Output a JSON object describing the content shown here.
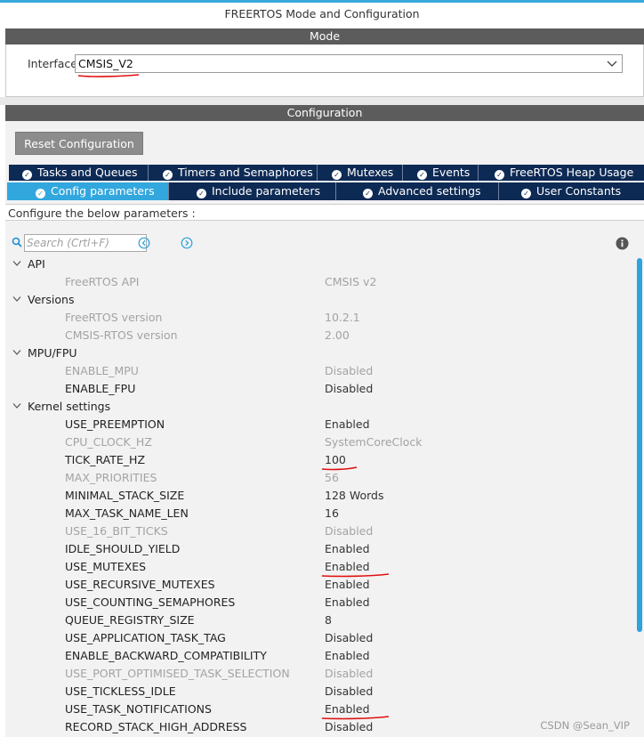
{
  "window": {
    "title": "FREERTOS Mode and Configuration"
  },
  "mode": {
    "header": "Mode",
    "interface_label": "Interface",
    "interface_value": "CMSIS_V2"
  },
  "configuration": {
    "header": "Configuration",
    "reset_label": "Reset Configuration",
    "tabs_row1": [
      {
        "label": "Tasks and Queues",
        "icon": "check-circle-icon"
      },
      {
        "label": "Timers and Semaphores",
        "icon": "check-circle-icon"
      },
      {
        "label": "Mutexes",
        "icon": "check-circle-icon"
      },
      {
        "label": "Events",
        "icon": "check-circle-icon"
      },
      {
        "label": "FreeRTOS Heap Usage",
        "icon": "check-circle-icon"
      }
    ],
    "tabs_row2": [
      {
        "label": "Config parameters",
        "icon": "check-circle-icon",
        "active": true
      },
      {
        "label": "Include parameters",
        "icon": "check-circle-icon"
      },
      {
        "label": "Advanced settings",
        "icon": "check-circle-icon"
      },
      {
        "label": "User Constants",
        "icon": "check-circle-icon"
      }
    ],
    "info_text": "Configure the below parameters :",
    "search_placeholder": "Search (Crtl+F)"
  },
  "groups": [
    {
      "label": "API",
      "params": [
        {
          "name": "FreeRTOS API",
          "value": "CMSIS v2",
          "disabled": true
        }
      ]
    },
    {
      "label": "Versions",
      "params": [
        {
          "name": "FreeRTOS version",
          "value": "10.2.1",
          "disabled": true
        },
        {
          "name": "CMSIS-RTOS version",
          "value": "2.00",
          "disabled": true
        }
      ]
    },
    {
      "label": "MPU/FPU",
      "params": [
        {
          "name": "ENABLE_MPU",
          "value": "Disabled",
          "disabled": true
        },
        {
          "name": "ENABLE_FPU",
          "value": "Disabled",
          "disabled": false
        }
      ]
    },
    {
      "label": "Kernel settings",
      "params": [
        {
          "name": "USE_PREEMPTION",
          "value": "Enabled",
          "disabled": false
        },
        {
          "name": "CPU_CLOCK_HZ",
          "value": "SystemCoreClock",
          "disabled": true
        },
        {
          "name": "TICK_RATE_HZ",
          "value": "100",
          "disabled": false,
          "marked": true
        },
        {
          "name": "MAX_PRIORITIES",
          "value": "56",
          "disabled": true
        },
        {
          "name": "MINIMAL_STACK_SIZE",
          "value": "128 Words",
          "disabled": false
        },
        {
          "name": "MAX_TASK_NAME_LEN",
          "value": "16",
          "disabled": false
        },
        {
          "name": "USE_16_BIT_TICKS",
          "value": "Disabled",
          "disabled": true
        },
        {
          "name": "IDLE_SHOULD_YIELD",
          "value": "Enabled",
          "disabled": false
        },
        {
          "name": "USE_MUTEXES",
          "value": "Enabled",
          "disabled": false,
          "marked": true
        },
        {
          "name": "USE_RECURSIVE_MUTEXES",
          "value": "Enabled",
          "disabled": false
        },
        {
          "name": "USE_COUNTING_SEMAPHORES",
          "value": "Enabled",
          "disabled": false
        },
        {
          "name": "QUEUE_REGISTRY_SIZE",
          "value": "8",
          "disabled": false
        },
        {
          "name": "USE_APPLICATION_TASK_TAG",
          "value": "Disabled",
          "disabled": false
        },
        {
          "name": "ENABLE_BACKWARD_COMPATIBILITY",
          "value": "Enabled",
          "disabled": false
        },
        {
          "name": "USE_PORT_OPTIMISED_TASK_SELECTION",
          "value": "Disabled",
          "disabled": true
        },
        {
          "name": "USE_TICKLESS_IDLE",
          "value": "Disabled",
          "disabled": false
        },
        {
          "name": "USE_TASK_NOTIFICATIONS",
          "value": "Enabled",
          "disabled": false,
          "marked": true
        },
        {
          "name": "RECORD_STACK_HIGH_ADDRESS",
          "value": "Disabled",
          "disabled": false
        }
      ]
    }
  ],
  "watermark": "CSDN @Sean_VIP",
  "colors": {
    "accent_blue": "#31a7de",
    "tab_dark": "#0d2a55",
    "section_bar": "#5c5c5c",
    "annotation_red": "#e01010"
  }
}
